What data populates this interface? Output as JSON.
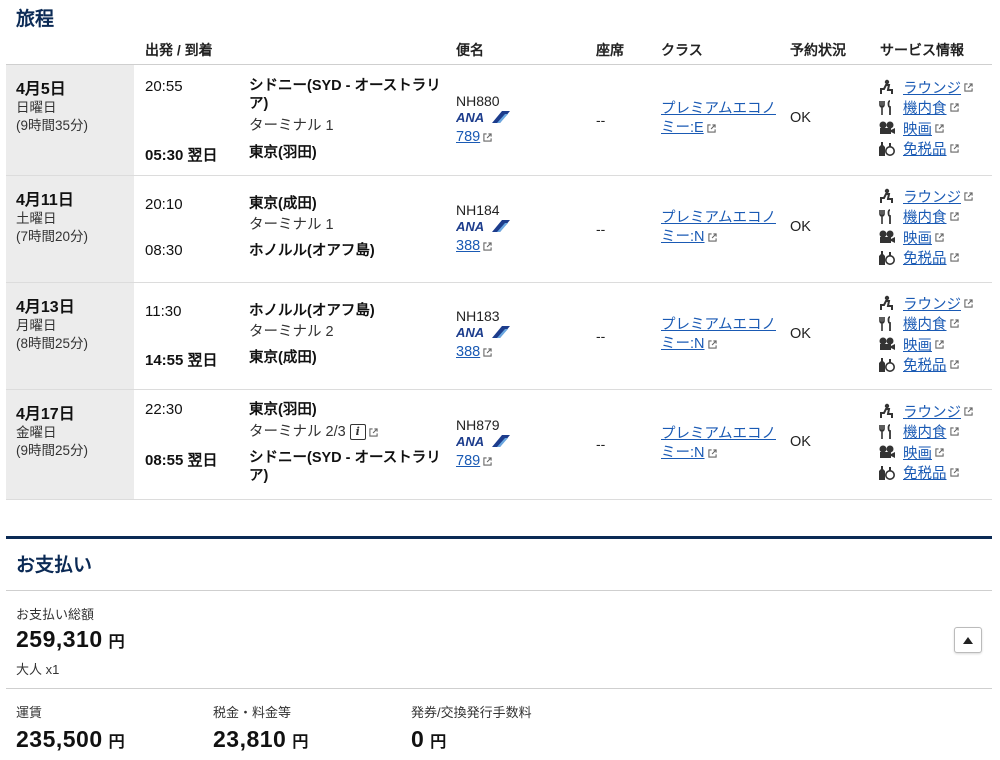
{
  "itinerary": {
    "title": "旅程",
    "headers": {
      "depart_arrive": "出発 / 到着",
      "flight": "便名",
      "seat": "座席",
      "class": "クラス",
      "status": "予約状況",
      "services": "サービス情報"
    },
    "segments": [
      {
        "date": "4月5日",
        "weekday": "日曜日",
        "duration": "(9時間35分)",
        "dep_time": "20:55",
        "dep_city": "シドニー(SYD - オーストラリア)",
        "dep_terminal": "ターミナル 1",
        "arr_time": "05:30 翌日",
        "arr_city": "東京(羽田)",
        "arr_terminal": "",
        "flight": "NH880",
        "airline": "ANA",
        "equipment": "789",
        "seat": "--",
        "cabin": "プレミアムエコノミー:E",
        "status": "OK"
      },
      {
        "date": "4月11日",
        "weekday": "土曜日",
        "duration": "(7時間20分)",
        "dep_time": "20:10",
        "dep_city": "東京(成田)",
        "dep_terminal": "ターミナル 1",
        "arr_time": "08:30",
        "arr_city": "ホノルル(オアフ島)",
        "arr_terminal": "",
        "flight": "NH184",
        "airline": "ANA",
        "equipment": "388",
        "seat": "--",
        "cabin": "プレミアムエコノミー:N",
        "status": "OK"
      },
      {
        "date": "4月13日",
        "weekday": "月曜日",
        "duration": "(8時間25分)",
        "dep_time": "11:30",
        "dep_city": "ホノルル(オアフ島)",
        "dep_terminal": "ターミナル 2",
        "arr_time": "14:55 翌日",
        "arr_city": "東京(成田)",
        "arr_terminal": "",
        "flight": "NH183",
        "airline": "ANA",
        "equipment": "388",
        "seat": "--",
        "cabin": "プレミアムエコノミー:N",
        "status": "OK"
      },
      {
        "date": "4月17日",
        "weekday": "金曜日",
        "duration": "(9時間25分)",
        "dep_time": "22:30",
        "dep_city": "東京(羽田)",
        "dep_terminal": "ターミナル 2/3",
        "arr_time": "08:55 翌日",
        "arr_city": "シドニー(SYD - オーストラリア)",
        "arr_terminal": "",
        "flight": "NH879",
        "airline": "ANA",
        "equipment": "789",
        "seat": "--",
        "cabin": "プレミアムエコノミー:N",
        "status": "OK"
      }
    ],
    "services": [
      "ラウンジ",
      "機内食",
      "映画",
      "免税品"
    ],
    "service_icons": [
      "lounge-icon",
      "meal-icon",
      "movie-icon",
      "duty-free-icon"
    ],
    "info_icon_label": "i"
  },
  "payment": {
    "title": "お支払い",
    "total_label": "お支払い総額",
    "total_value": "259,310",
    "currency": "円",
    "passengers": "大人 x1",
    "breakdown": [
      {
        "label": "運賃",
        "value": "235,500"
      },
      {
        "label": "税金・料金等",
        "value": "23,810"
      },
      {
        "label": "発券/交換発行手数料",
        "value": "0"
      }
    ]
  },
  "colors": {
    "heading": "#0b2a55",
    "link": "#1a5ab4",
    "ana_blue": "#1c3c8c",
    "date_cell_bg": "#ececec"
  }
}
